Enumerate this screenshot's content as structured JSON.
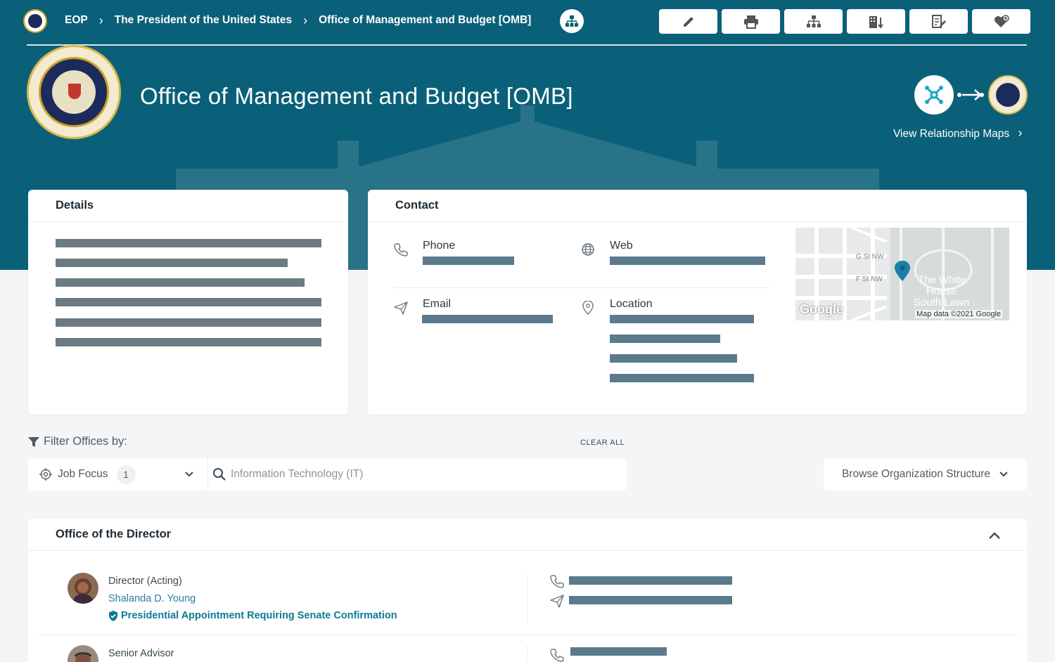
{
  "breadcrumb": {
    "items": [
      "EOP",
      "The President of the United States",
      "Office of Management and Budget [OMB]"
    ],
    "separator": "›"
  },
  "toolbar": {
    "buttons": [
      "edit-icon",
      "print-icon",
      "org-chart-icon",
      "building-icon",
      "document-edit-icon",
      "heart-add-icon"
    ]
  },
  "header": {
    "title": "Office of Management and Budget [OMB]",
    "relationship_link": "View Relationship Maps",
    "relationship_chevron": "›"
  },
  "details": {
    "heading": "Details"
  },
  "contact": {
    "heading": "Contact",
    "phone_label": "Phone",
    "web_label": "Web",
    "email_label": "Email",
    "location_label": "Location",
    "map": {
      "street_1": "G St NW",
      "street_2": "F St NW",
      "place_line_1": "The White",
      "place_line_2": "House",
      "place_line_3": "South Lawn",
      "logo": "Google",
      "attribution": "Map data ©2021 Google"
    }
  },
  "filters": {
    "title": "Filter Offices by:",
    "clear_all": "CLEAR ALL",
    "job_focus_label": "Job Focus",
    "job_focus_count": "1",
    "search_placeholder": "Information Technology (IT)",
    "browse_label": "Browse Organization Structure"
  },
  "office": {
    "title": "Office of the Director",
    "people": [
      {
        "role": "Director (Acting)",
        "name": "Shalanda D. Young",
        "badge": "Presidential Appointment Requiring Senate Confirmation"
      },
      {
        "role": "Senior Advisor"
      }
    ]
  },
  "colors": {
    "brand": "#0b6079",
    "accent": "#0b7a96",
    "map_pin": "#1b7fa8",
    "redacted_bar": "#5b7a8d"
  }
}
